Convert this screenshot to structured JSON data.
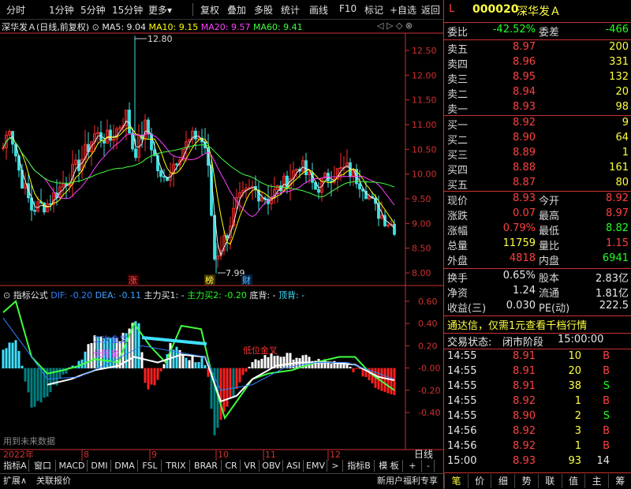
{
  "toolbar": {
    "items": [
      "分时",
      "1分钟",
      "5分钟",
      "15分钟",
      "更多",
      "复权",
      "叠加",
      "多股",
      "统计",
      "画线",
      "F10",
      "标记",
      "+自选",
      "返回"
    ],
    "more_arrow": "▾"
  },
  "kline": {
    "title": "深华发Ａ(日线,前复权)",
    "ma5": "MA5: 9.04",
    "ma10": "MA10: 9.15",
    "ma20": "MA20: 9.57",
    "ma60": "MA60: 9.41",
    "high_label": "12.80",
    "low_label": "7.99",
    "y_ticks": [
      "12.50",
      "12.00",
      "11.50",
      "11.00",
      "10.50",
      "10.00",
      "9.50",
      "9.00",
      "8.50",
      "8.00"
    ],
    "markers": [
      "涨",
      "榜",
      "财"
    ]
  },
  "indicator": {
    "title": "指标公式",
    "dif": "DIF: -0.20",
    "dea": "DEA: -0.11",
    "buy1": "主力买1: -",
    "buy2": "主力买2: -0.20",
    "bottom": "底背: -",
    "top": "顶背: -",
    "y_ticks": [
      "0.60",
      "0.40",
      "0.20",
      "-0.00",
      "-0.20",
      "-0.40"
    ],
    "ann1": "二次金叉",
    "ann2": "长阳金",
    "ann3": "低位金叉",
    "footer": "用到未来数据"
  },
  "axis": {
    "x_labels": [
      "2022年",
      "8",
      "9",
      "10",
      "11",
      "12"
    ],
    "period": "日线"
  },
  "tabs": [
    "指标A",
    "窗口",
    "MACD",
    "DMI",
    "DMA",
    "FSL",
    "TRIX",
    "BRAR",
    "CR",
    "VR",
    "OBV",
    "ASI",
    "EMV",
    ">",
    "指标B",
    "模 板",
    "+",
    "-"
  ],
  "bottom_left": [
    "扩展∧",
    "关联报价"
  ],
  "bottom_right_text": "新用户福利专享",
  "right_tabs": [
    "笔",
    "价",
    "细",
    "势",
    "联",
    "值",
    "主",
    "筹"
  ],
  "quote": {
    "mark": "L",
    "code": "000020",
    "name": "深华发Ａ",
    "weibi_label": "委比",
    "weibi": "-42.52%",
    "weicha_label": "委差",
    "weicha": "-466",
    "asks": [
      {
        "label": "卖五",
        "price": "8.97",
        "vol": "200"
      },
      {
        "label": "卖四",
        "price": "8.96",
        "vol": "331"
      },
      {
        "label": "卖三",
        "price": "8.95",
        "vol": "132"
      },
      {
        "label": "卖二",
        "price": "8.94",
        "vol": "20"
      },
      {
        "label": "卖一",
        "price": "8.93",
        "vol": "98"
      }
    ],
    "bids": [
      {
        "label": "买一",
        "price": "8.92",
        "vol": "9"
      },
      {
        "label": "买二",
        "price": "8.90",
        "vol": "64"
      },
      {
        "label": "买三",
        "price": "8.89",
        "vol": "1"
      },
      {
        "label": "买四",
        "price": "8.88",
        "vol": "161"
      },
      {
        "label": "买五",
        "price": "8.87",
        "vol": "80"
      }
    ],
    "stats": [
      {
        "l1": "现价",
        "v1": "8.93",
        "c1": "red",
        "l2": "今开",
        "v2": "8.92",
        "c2": "red"
      },
      {
        "l1": "涨跌",
        "v1": "0.07",
        "c1": "red",
        "l2": "最高",
        "v2": "8.97",
        "c2": "red"
      },
      {
        "l1": "涨幅",
        "v1": "0.79%",
        "c1": "red",
        "l2": "最低",
        "v2": "8.82",
        "c2": "grn"
      },
      {
        "l1": "总量",
        "v1": "11759",
        "c1": "yel",
        "l2": "量比",
        "v2": "1.15",
        "c2": "red"
      },
      {
        "l1": "外盘",
        "v1": "4818",
        "c1": "red",
        "l2": "内盘",
        "v2": "6941",
        "c2": "grn"
      }
    ],
    "stats2": [
      {
        "l1": "换手",
        "v1": "0.65%",
        "l2": "股本",
        "v2": "2.83亿"
      },
      {
        "l1": "净资",
        "v1": "1.24",
        "l2": "流通",
        "v2": "1.81亿"
      },
      {
        "l1": "收益(三)",
        "v1": "0.030",
        "l2": "PE(动)",
        "v2": "222.5"
      }
    ],
    "promo": "通达信，仅需1元查看千档行情",
    "status_label": "交易状态:",
    "status": "闭市阶段",
    "status_time": "15:00:00",
    "ticks": [
      {
        "t": "14:55",
        "p": "8.91",
        "pc": "red",
        "v": "10",
        "f": "B"
      },
      {
        "t": "14:55",
        "p": "8.91",
        "pc": "red",
        "v": "20",
        "f": "B"
      },
      {
        "t": "14:55",
        "p": "8.91",
        "pc": "red",
        "v": "38",
        "f": "S"
      },
      {
        "t": "14:55",
        "p": "8.92",
        "pc": "red",
        "v": "1",
        "f": "B"
      },
      {
        "t": "14:55",
        "p": "8.90",
        "pc": "red",
        "v": "2",
        "f": "S"
      },
      {
        "t": "14:56",
        "p": "8.92",
        "pc": "red",
        "v": "3",
        "f": "B"
      },
      {
        "t": "14:56",
        "p": "8.92",
        "pc": "red",
        "v": "1",
        "f": "B"
      },
      {
        "t": "15:00",
        "p": "8.93",
        "pc": "red",
        "v": "93",
        "f": "14"
      }
    ]
  }
}
